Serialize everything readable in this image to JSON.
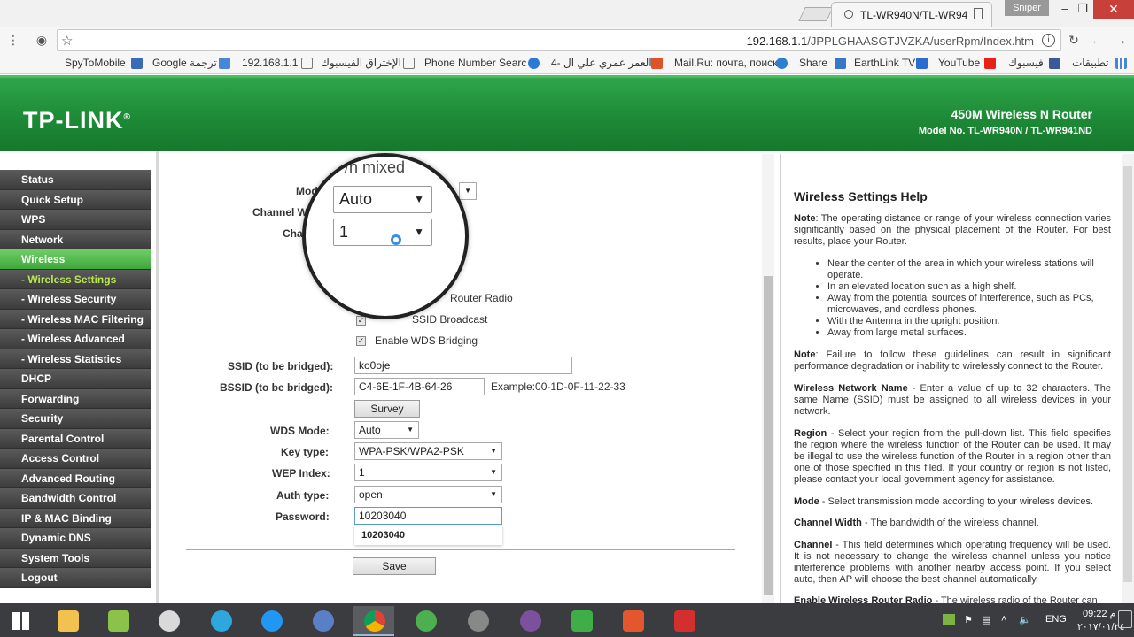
{
  "browser": {
    "tab_title": "TL-WR940N/TL-WR941N",
    "profile": "Sniper",
    "url_host": "192.168.1.1",
    "url_path": "/JPPLGHAASGTJVZKA/userRpm/Index.htm",
    "bookmarks": [
      "SpyToMobile",
      "Google ترجمة",
      "192.168.1.1",
      "الإختراق الفيسبوك",
      "Phone Number Searc",
      "4- العمر عمري علي ال",
      "Mail.Ru: почта, поиск",
      "Share",
      "EarthLink TV",
      "YouTube",
      "فيسبوك",
      "تطبيقات"
    ]
  },
  "header": {
    "logo": "TP-LINK",
    "logo_mark": "®",
    "product": "450M Wireless N Router",
    "model": "Model No. TL-WR940N / TL-WR941ND"
  },
  "menu": [
    {
      "label": "Status"
    },
    {
      "label": "Quick Setup"
    },
    {
      "label": "WPS"
    },
    {
      "label": "Network"
    },
    {
      "label": "Wireless"
    },
    {
      "label": "- Wireless Settings"
    },
    {
      "label": "- Wireless Security"
    },
    {
      "label": "- Wireless MAC Filtering"
    },
    {
      "label": "- Wireless Advanced"
    },
    {
      "label": "- Wireless Statistics"
    },
    {
      "label": "DHCP"
    },
    {
      "label": "Forwarding"
    },
    {
      "label": "Security"
    },
    {
      "label": "Parental Control"
    },
    {
      "label": "Access Control"
    },
    {
      "label": "Advanced Routing"
    },
    {
      "label": "Bandwidth Control"
    },
    {
      "label": "IP & MAC Binding"
    },
    {
      "label": "Dynamic DNS"
    },
    {
      "label": "System Tools"
    },
    {
      "label": "Logout"
    }
  ],
  "form": {
    "mode_label": "Mode",
    "channel_width_label": "Channel Wid",
    "channel_label": "Chan",
    "enable_router_radio": "Router Radio",
    "ssid_broadcast": "SSID Broadcast",
    "enable_wds": "Enable WDS Bridging",
    "ssid_label": "SSID (to be bridged):",
    "ssid_value": "ko0oje",
    "bssid_label": "BSSID (to be bridged):",
    "bssid_value": "C4-6E-1F-4B-64-26",
    "bssid_example": "Example:00-1D-0F-11-22-33",
    "survey_button": "Survey",
    "wds_mode_label": "WDS Mode:",
    "wds_mode_value": "Auto",
    "key_type_label": "Key type:",
    "key_type_value": "WPA-PSK/WPA2-PSK",
    "wep_index_label": "WEP Index:",
    "wep_index_value": "1",
    "auth_type_label": "Auth type:",
    "auth_type_value": "open",
    "password_label": "Password:",
    "password_value": "10203040",
    "autocomplete_value": "10203040",
    "save_button": "Save"
  },
  "magnifier": {
    "mode_text": "/n mixed",
    "width_value": "Auto",
    "channel_value": "1"
  },
  "help": {
    "title": "Wireless Settings Help",
    "note_label": "Note",
    "note_text": ": The operating distance or range of your wireless connection varies significantly based on the physical placement of the Router. For best results, place your Router.",
    "bullets": [
      "Near the center of the area in which your wireless stations will operate.",
      "In an elevated location such as a high shelf.",
      "Away from the potential sources of interference, such as PCs, microwaves, and cordless phones.",
      "With the Antenna in the upright position.",
      "Away from large metal surfaces."
    ],
    "note2_label": "Note",
    "note2_text": ": Failure to follow these guidelines can result in significant performance degradation or inability to wirelessly connect to the Router.",
    "name_label": "Wireless Network Name",
    "name_text": " - Enter a value of up to 32 characters. The same Name (SSID) must be assigned to all wireless devices in your network.",
    "region_label": "Region",
    "region_text": " - Select your region from the pull-down list. This field specifies the region where the wireless function of the Router can be used. It may be illegal to use the wireless function of the Router in a region other than one of those specified in this filed. If your country or region is not listed, please contact your local government agency for assistance.",
    "mode_label": "Mode",
    "mode_text": " - Select transmission mode according to your wireless devices.",
    "cw_label": "Channel Width",
    "cw_text": " - The bandwidth of the wireless channel.",
    "ch_label": "Channel",
    "ch_text": " - This field determines which operating frequency will be used. It is not necessary to change the wireless channel unless you notice interference problems with another nearby access point. If you select auto, then AP will choose the best channel automatically.",
    "radio_label": "Enable Wireless Router Radio",
    "radio_text": " - The wireless radio of the Router can"
  },
  "taskbar": {
    "lang": "ENG",
    "time": "09:22 م",
    "date": "٢٠١٧/٠١/٢٤"
  }
}
